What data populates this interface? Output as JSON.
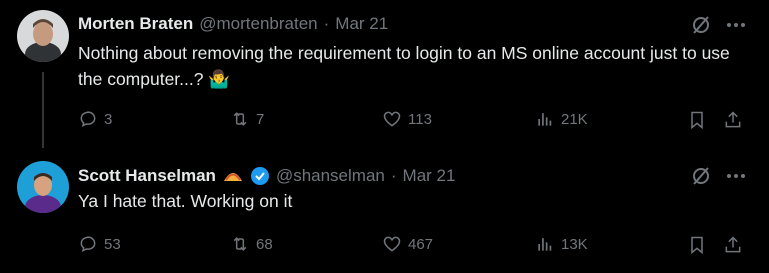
{
  "tweets": [
    {
      "author": "Morten Braten",
      "handle": "@mortenbraten",
      "separator": "·",
      "date": "Mar 21",
      "text": "Nothing about removing the requirement to login to an MS online account just to use the computer...? 🤷‍♂️",
      "replies": "3",
      "retweets": "7",
      "likes": "113",
      "views": "21K"
    },
    {
      "author": "Scott Hanselman",
      "handle": "@shanselman",
      "separator": "·",
      "date": "Mar 21",
      "text": "Ya I hate that. Working on it",
      "replies": "53",
      "retweets": "68",
      "likes": "467",
      "views": "13K"
    }
  ],
  "colors": {
    "background": "#000000",
    "text": "#e7e9ea",
    "muted": "#71767b",
    "verified": "#1d9bf0",
    "thread_line": "#333639"
  },
  "icons": [
    "grok-icon",
    "more-icon",
    "reply-icon",
    "retweet-icon",
    "like-icon",
    "views-icon",
    "bookmark-icon",
    "share-icon",
    "taco-emoji-icon",
    "verified-icon"
  ]
}
